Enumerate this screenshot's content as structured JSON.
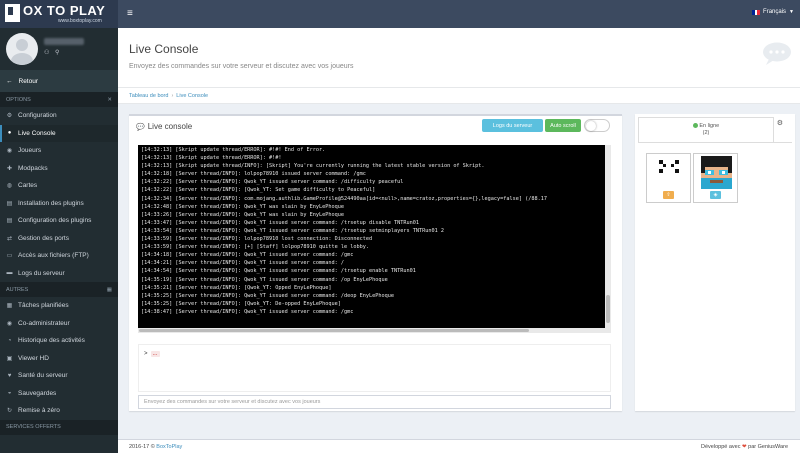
{
  "brand": {
    "title": "OX TO PLAY",
    "sub": "www.boxtoplay.com"
  },
  "header": {
    "language": "Français",
    "flag_colors": [
      "#002395",
      "#ffffff",
      "#ed2939"
    ]
  },
  "user": {
    "icons": "⚇ ⚲"
  },
  "sidebar": {
    "back_label": "Retour",
    "sections": [
      {
        "title": "OPTIONS",
        "items": [
          {
            "label": "Configuration",
            "icon": "⚙",
            "active": false
          },
          {
            "label": "Live Console",
            "icon": "●",
            "active": true
          },
          {
            "label": "Joueurs",
            "icon": "◉",
            "active": false
          },
          {
            "label": "Modpacks",
            "icon": "✚",
            "active": false
          },
          {
            "label": "Cartes",
            "icon": "◍",
            "active": false
          },
          {
            "label": "Installation des plugins",
            "icon": "▤",
            "active": false
          },
          {
            "label": "Configuration des plugins",
            "icon": "▤",
            "active": false
          },
          {
            "label": "Gestion des ports",
            "icon": "⇄",
            "active": false
          },
          {
            "label": "Accès aux fichiers (FTP)",
            "icon": "▭",
            "active": false
          },
          {
            "label": "Logs du serveur",
            "icon": "▬",
            "active": false
          }
        ]
      },
      {
        "title": "AUTRES",
        "items": [
          {
            "label": "Tâches planifiées",
            "icon": "▦",
            "active": false
          },
          {
            "label": "Co-administrateur",
            "icon": "◉",
            "active": false
          },
          {
            "label": "Historique des activités",
            "icon": "◔",
            "active": false
          },
          {
            "label": "Viewer HD",
            "icon": "▣",
            "active": false
          },
          {
            "label": "Santé du serveur",
            "icon": "♥",
            "active": false
          },
          {
            "label": "Sauvegardes",
            "icon": "◒",
            "active": false
          },
          {
            "label": "Remise à zéro",
            "icon": "↻",
            "active": false
          }
        ]
      },
      {
        "title": "SERVICES OFFERTS",
        "items": []
      }
    ]
  },
  "page": {
    "title": "Live Console",
    "subtitle": "Envoyez des commandes sur votre serveur et discutez avec vos joueurs"
  },
  "breadcrumb": {
    "home": "Tableau de bord",
    "current": "Live Console"
  },
  "console": {
    "title": "Live console",
    "logs_button": "Logs du serveur",
    "autoscroll_button": "Auto scroll",
    "autoscroll_on": false,
    "lines": [
      "[14:32:13] [Skript update thread/ERROR]: #!#! End of Error.",
      "[14:32:13] [Skript update thread/ERROR]: #!#!",
      "[14:32:13] [Skript update thread/INFO]: [Skript] You're currently running the latest stable version of Skript.",
      "[14:32:18] [Server thread/INFO]: lolpop78910 issued server command: /gmc",
      "[14:32:22] [Server thread/INFO]: Qwok_YT issued server command: /difficulty peaceful",
      "[14:32:22] [Server thread/INFO]: [Qwok_YT: Set game difficulty to Peaceful]",
      "[14:32:34] [Server thread/INFO]: com.mojang.authlib.GameProfile@524490aa[id=<null>,name=cratoz,properties={},legacy=false] (/88.17",
      "[14:32:48] [Server thread/INFO]: Qwok_YT was slain by EnyLePhoque",
      "[14:33:26] [Server thread/INFO]: Qwok_YT was slain by EnyLePhoque",
      "[14:33:47] [Server thread/INFO]: Qwok_YT issued server command: /trsetup disable TNTRun01",
      "[14:33:54] [Server thread/INFO]: Qwok_YT issued server command: /trsetup setminplayers TNTRun01 2",
      "[14:33:59] [Server thread/INFO]: lolpop78910 lost connection: Disconnected",
      "[14:33:59] [Server thread/INFO]: [+] [Staff] lolpop78910 quitte le lobby.",
      "[14:34:18] [Server thread/INFO]: Qwok_YT issued server command: /gmc",
      "[14:34:21] [Server thread/INFO]: Qwok_YT issued server command: /",
      "[14:34:54] [Server thread/INFO]: Qwok_YT issued server command: /trsetup enable TNTRun01",
      "[14:35:19] [Server thread/INFO]: Qwok_YT issued server command: /op EnyLePhoque",
      "[14:35:21] [Server thread/INFO]: [Qwok_YT: Opped EnyLePhoque]",
      "[14:35:25] [Server thread/INFO]: Qwok_YT issued server command: /deop EnyLePhoque",
      "[14:35:25] [Server thread/INFO]: [Qwok_YT: De-opped EnyLePhoque]",
      "[14:38:47] [Server thread/INFO]: Qwok_YT issued server command: /gmc"
    ],
    "prompt_symbol": ">",
    "prompt_text": "...",
    "input_placeholder": "Envoyez des commandes sur votre serveur et discutez avec vos joueurs"
  },
  "players": {
    "online_label": "En ligne",
    "online_count": "(2)",
    "online_color": "#5cb85c",
    "list": [
      {
        "badge": "⇧",
        "badge_color": "#f0ad4e"
      },
      {
        "badge": "◈",
        "badge_color": "#5bc0de"
      }
    ]
  },
  "footer": {
    "copyright": "2016-17 ©",
    "company": "BoxToPlay",
    "credit_prefix": "Développé avec",
    "heart": "❤",
    "credit_suffix": "par GeniusWare"
  }
}
